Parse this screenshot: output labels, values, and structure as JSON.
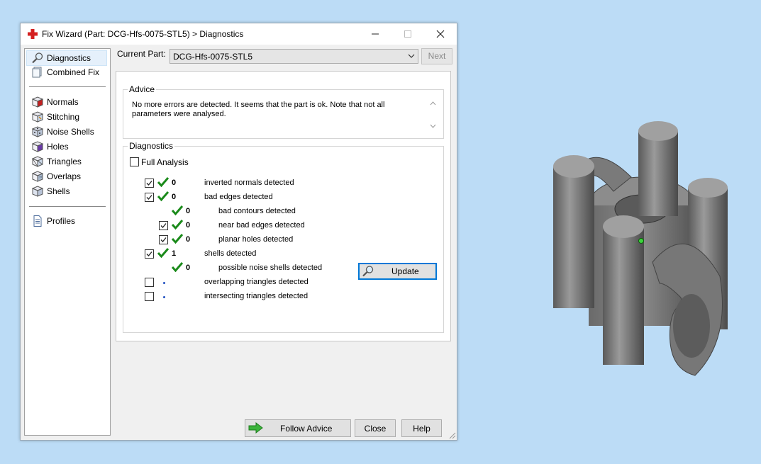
{
  "window": {
    "title": "Fix Wizard (Part: DCG-Hfs-0075-STL5) > Diagnostics"
  },
  "sidebar": {
    "items": [
      {
        "label": "Diagnostics",
        "icon": "magnifier-icon"
      },
      {
        "label": "Combined Fix",
        "icon": "cube-stack-icon"
      },
      {
        "label": "Normals",
        "icon": "normals-cube-icon"
      },
      {
        "label": "Stitching",
        "icon": "stitching-cube-icon"
      },
      {
        "label": "Noise Shells",
        "icon": "noise-shells-icon"
      },
      {
        "label": "Holes",
        "icon": "holes-cube-icon"
      },
      {
        "label": "Triangles",
        "icon": "triangles-cube-icon"
      },
      {
        "label": "Overlaps",
        "icon": "overlaps-cube-icon"
      },
      {
        "label": "Shells",
        "icon": "shells-cube-icon"
      },
      {
        "label": "Profiles",
        "icon": "document-icon"
      }
    ]
  },
  "current_part": {
    "label": "Current Part:",
    "value": "DCG-Hfs-0075-STL5"
  },
  "next_label": "Next",
  "advice": {
    "title": "Advice",
    "text": "No more errors are detected. It seems that the part is ok. Note that not all parameters were analysed."
  },
  "diagnostics": {
    "title": "Diagnostics",
    "full_analysis_label": "Full Analysis",
    "rows": [
      {
        "checkbox": true,
        "checked": true,
        "status": "ok",
        "count": "0",
        "label": "inverted normals detected",
        "indent": 0
      },
      {
        "checkbox": true,
        "checked": true,
        "status": "ok",
        "count": "0",
        "label": "bad edges detected",
        "indent": 0
      },
      {
        "checkbox": false,
        "checked": false,
        "status": "ok",
        "count": "0",
        "label": "bad contours detected",
        "indent": 1
      },
      {
        "checkbox": true,
        "checked": true,
        "status": "ok",
        "count": "0",
        "label": "near bad edges detected",
        "indent": 1
      },
      {
        "checkbox": true,
        "checked": true,
        "status": "ok",
        "count": "0",
        "label": "planar holes detected",
        "indent": 1
      },
      {
        "checkbox": true,
        "checked": true,
        "status": "ok",
        "count": "1",
        "label": "shells detected",
        "indent": 0
      },
      {
        "checkbox": false,
        "checked": false,
        "status": "ok",
        "count": "0",
        "label": "possible noise shells detected",
        "indent": 1
      },
      {
        "checkbox": true,
        "checked": false,
        "status": "not-run",
        "count": "",
        "label": "overlapping triangles detected",
        "indent": 0
      },
      {
        "checkbox": true,
        "checked": false,
        "status": "not-run",
        "count": "",
        "label": "intersecting triangles detected",
        "indent": 0
      }
    ],
    "update_label": "Update"
  },
  "buttons": {
    "follow_advice": "Follow Advice",
    "close": "Close",
    "help": "Help"
  },
  "colors": {
    "desktop": "#bcdcf6",
    "check_green": "#1a8a1a",
    "accent": "#0078d7"
  }
}
